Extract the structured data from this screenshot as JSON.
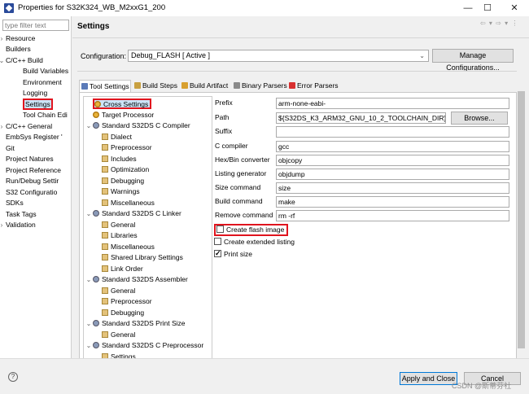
{
  "window": {
    "title": "Properties for S32K324_WB_M2xxG1_200",
    "controls": [
      "—",
      "☐",
      "✕"
    ]
  },
  "sidebar": {
    "filter_placeholder": "type filter text",
    "items": [
      {
        "label": "Resource",
        "chevron": "›",
        "selected": false
      },
      {
        "label": "Builders",
        "chevron": "",
        "selected": false
      },
      {
        "label": "C/C++ Build",
        "chevron": "⌄",
        "selected": false
      },
      {
        "label": "Build Variables",
        "chevron": "",
        "selected": false
      },
      {
        "label": "Environment",
        "chevron": "",
        "selected": false
      },
      {
        "label": "Logging",
        "chevron": "",
        "selected": false
      },
      {
        "label": "Settings",
        "chevron": "",
        "selected": true
      },
      {
        "label": "Tool Chain Edi",
        "chevron": "",
        "selected": false
      },
      {
        "label": "C/C++ General",
        "chevron": "›",
        "selected": false
      },
      {
        "label": "EmbSys Register '",
        "chevron": "",
        "selected": false
      },
      {
        "label": "Git",
        "chevron": "",
        "selected": false
      },
      {
        "label": "Project Natures",
        "chevron": "",
        "selected": false
      },
      {
        "label": "Project Reference",
        "chevron": "",
        "selected": false
      },
      {
        "label": "Run/Debug Settir",
        "chevron": "",
        "selected": false
      },
      {
        "label": "S32 Configuratio",
        "chevron": "",
        "selected": false
      },
      {
        "label": "SDKs",
        "chevron": "",
        "selected": false
      },
      {
        "label": "Task Tags",
        "chevron": "",
        "selected": false
      },
      {
        "label": "Validation",
        "chevron": "›",
        "selected": false
      }
    ]
  },
  "header": {
    "title": "Settings",
    "nav_arrows": "⇦ ▾ ⇨ ▾ ⋮"
  },
  "configuration": {
    "label": "Configuration:",
    "value": "Debug_FLASH  [ Active ]",
    "manage_button": "Manage Configurations..."
  },
  "tabs": [
    {
      "label": "Tool Settings",
      "active": true,
      "icon_color": "#5a7ab8"
    },
    {
      "label": "Build Steps",
      "active": false,
      "icon_color": "#c8a040"
    },
    {
      "label": "Build Artifact",
      "active": false,
      "icon_color": "#d8a030"
    },
    {
      "label": "Binary Parsers",
      "active": false,
      "icon_color": "#8a8a8a"
    },
    {
      "label": "Error Parsers",
      "active": false,
      "icon_color": "#d83030"
    }
  ],
  "tree": [
    {
      "label": "Cross Settings",
      "level": 0,
      "chevron": "",
      "icon": "tool",
      "highlighted": true
    },
    {
      "label": "Target Processor",
      "level": 0,
      "chevron": "",
      "icon": "tool",
      "highlighted": false
    },
    {
      "label": "Standard S32DS C Compiler",
      "level": 0,
      "chevron": "⌄",
      "icon": "gear",
      "highlighted": false
    },
    {
      "label": "Dialect",
      "level": 1,
      "chevron": "",
      "icon": "leaf",
      "highlighted": false
    },
    {
      "label": "Preprocessor",
      "level": 1,
      "chevron": "",
      "icon": "leaf",
      "highlighted": false
    },
    {
      "label": "Includes",
      "level": 1,
      "chevron": "",
      "icon": "leaf",
      "highlighted": false
    },
    {
      "label": "Optimization",
      "level": 1,
      "chevron": "",
      "icon": "leaf",
      "highlighted": false
    },
    {
      "label": "Debugging",
      "level": 1,
      "chevron": "",
      "icon": "leaf",
      "highlighted": false
    },
    {
      "label": "Warnings",
      "level": 1,
      "chevron": "",
      "icon": "leaf",
      "highlighted": false
    },
    {
      "label": "Miscellaneous",
      "level": 1,
      "chevron": "",
      "icon": "leaf",
      "highlighted": false
    },
    {
      "label": "Standard S32DS C Linker",
      "level": 0,
      "chevron": "⌄",
      "icon": "gear",
      "highlighted": false
    },
    {
      "label": "General",
      "level": 1,
      "chevron": "",
      "icon": "leaf",
      "highlighted": false
    },
    {
      "label": "Libraries",
      "level": 1,
      "chevron": "",
      "icon": "leaf",
      "highlighted": false
    },
    {
      "label": "Miscellaneous",
      "level": 1,
      "chevron": "",
      "icon": "leaf",
      "highlighted": false
    },
    {
      "label": "Shared Library Settings",
      "level": 1,
      "chevron": "",
      "icon": "leaf",
      "highlighted": false
    },
    {
      "label": "Link Order",
      "level": 1,
      "chevron": "",
      "icon": "leaf",
      "highlighted": false
    },
    {
      "label": "Standard S32DS Assembler",
      "level": 0,
      "chevron": "⌄",
      "icon": "gear",
      "highlighted": false
    },
    {
      "label": "General",
      "level": 1,
      "chevron": "",
      "icon": "leaf",
      "highlighted": false
    },
    {
      "label": "Preprocessor",
      "level": 1,
      "chevron": "",
      "icon": "leaf",
      "highlighted": false
    },
    {
      "label": "Debugging",
      "level": 1,
      "chevron": "",
      "icon": "leaf",
      "highlighted": false
    },
    {
      "label": "Standard S32DS Print Size",
      "level": 0,
      "chevron": "⌄",
      "icon": "gear",
      "highlighted": false
    },
    {
      "label": "General",
      "level": 1,
      "chevron": "",
      "icon": "leaf",
      "highlighted": false
    },
    {
      "label": "Standard S32DS C Preprocessor",
      "level": 0,
      "chevron": "⌄",
      "icon": "gear",
      "highlighted": false
    },
    {
      "label": "Settings",
      "level": 1,
      "chevron": "",
      "icon": "leaf",
      "highlighted": false
    }
  ],
  "fields": [
    {
      "label": "Prefix",
      "value": "arm-none-eabi-"
    },
    {
      "label": "Path",
      "value": "${S32DS_K3_ARM32_GNU_10_2_TOOLCHAIN_DIR}"
    },
    {
      "label": "Suffix",
      "value": ""
    },
    {
      "label": "C compiler",
      "value": "gcc"
    },
    {
      "label": "Hex/Bin converter",
      "value": "objcopy"
    },
    {
      "label": "Listing generator",
      "value": "objdump"
    },
    {
      "label": "Size command",
      "value": "size"
    },
    {
      "label": "Build command",
      "value": "make"
    },
    {
      "label": "Remove command",
      "value": "rm -rf"
    }
  ],
  "browse_button": "Browse...",
  "checkboxes": [
    {
      "label": "Create flash image",
      "checked": false,
      "highlighted": true
    },
    {
      "label": "Create extended listing",
      "checked": false,
      "highlighted": false
    },
    {
      "label": "Print size",
      "checked": true,
      "highlighted": false
    }
  ],
  "footer": {
    "help": "?",
    "apply_close": "Apply and Close",
    "cancel": "Cancel",
    "watermark": "CSDN @斯蒂芬社"
  }
}
